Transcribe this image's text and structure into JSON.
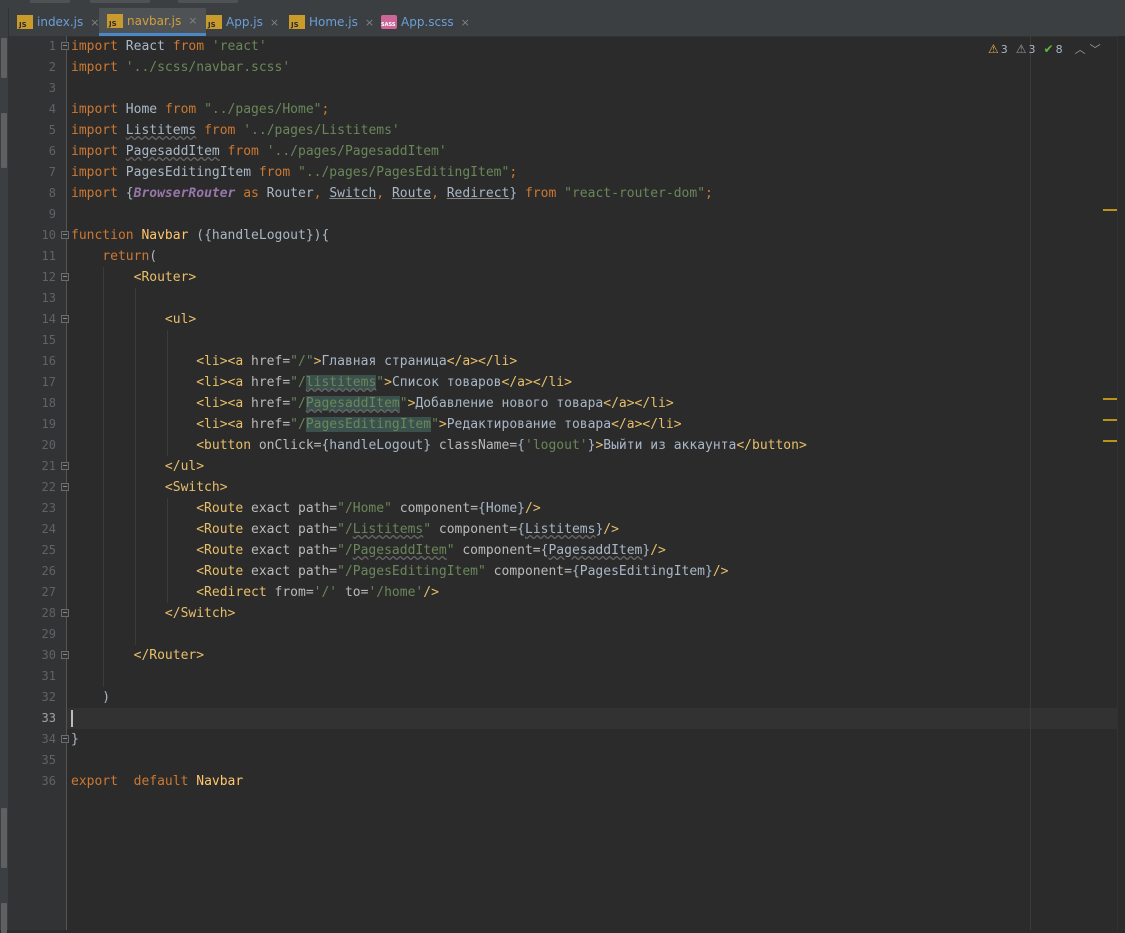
{
  "tabs": [
    {
      "label": "index.js",
      "icon": "js-file-icon",
      "active": false
    },
    {
      "label": "navbar.js",
      "icon": "js-file-icon",
      "active": true
    },
    {
      "label": "App.js",
      "icon": "js-file-icon",
      "active": false
    },
    {
      "label": "Home.js",
      "icon": "js-file-icon",
      "active": false
    },
    {
      "label": "App.scss",
      "icon": "scss-file-icon",
      "active": false
    }
  ],
  "tab_close_glyph": "×",
  "inspections": {
    "errors": "3",
    "warnings": "3",
    "ok": "8"
  },
  "current_line": 33,
  "line_count": 36,
  "colors": {
    "background": "#2b2b2b",
    "gutter": "#313335",
    "keyword": "#cc7832",
    "string": "#6a8759",
    "tag": "#e8bf6a",
    "function": "#ffc66d",
    "text": "#a9b7c6",
    "active_tab_underline": "#4a88c7"
  }
}
